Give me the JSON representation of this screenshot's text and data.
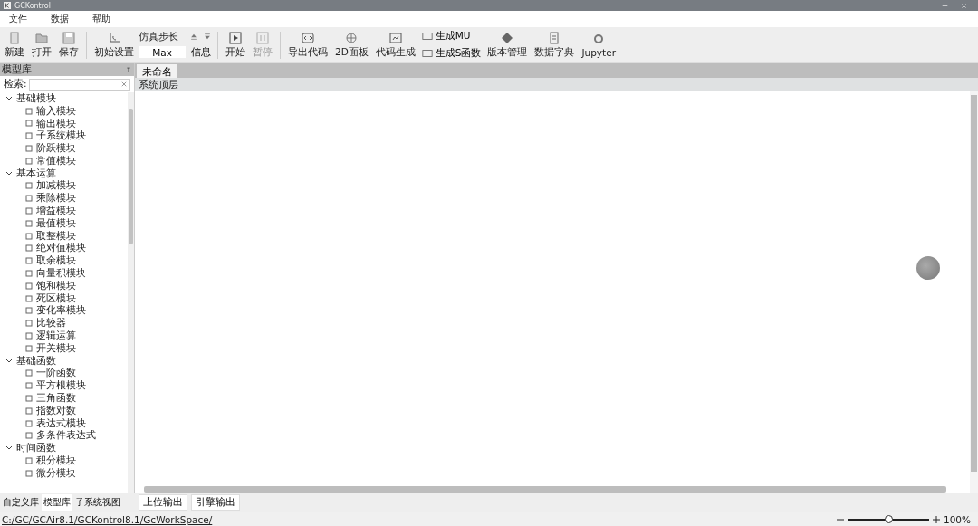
{
  "window": {
    "title": "GCKontrol"
  },
  "menu": [
    "文件",
    "数据",
    "帮助"
  ],
  "toolbar": {
    "file_buttons": [
      {
        "label": "新建"
      },
      {
        "label": "打开"
      },
      {
        "label": "保存"
      }
    ],
    "init_button": {
      "label": "初始设置"
    },
    "sim": {
      "label": "仿真步长",
      "value": "Max",
      "info": "信息"
    },
    "run_buttons": [
      {
        "label": "开始",
        "disabled": false
      },
      {
        "label": "暂停",
        "disabled": true
      }
    ],
    "tool_buttons": [
      {
        "label": "导出代码"
      },
      {
        "label": "2D面板"
      },
      {
        "label": "代码生成"
      }
    ],
    "small_buttons": [
      {
        "label": "生成MU"
      },
      {
        "label": "生成S函数"
      }
    ],
    "extra_buttons": [
      {
        "label": "版本管理"
      },
      {
        "label": "数据字典"
      },
      {
        "label": "Jupyter"
      }
    ]
  },
  "library": {
    "title": "模型库",
    "search_label": "检索:",
    "tree": [
      {
        "label": "基础模块",
        "expanded": true,
        "children": [
          {
            "label": "输入模块"
          },
          {
            "label": "输出模块"
          },
          {
            "label": "子系统模块"
          },
          {
            "label": "阶跃模块"
          },
          {
            "label": "常值模块"
          }
        ]
      },
      {
        "label": "基本运算",
        "expanded": true,
        "children": [
          {
            "label": "加减模块"
          },
          {
            "label": "乘除模块"
          },
          {
            "label": "增益模块"
          },
          {
            "label": "最值模块"
          },
          {
            "label": "取整模块"
          },
          {
            "label": "绝对值模块"
          },
          {
            "label": "取余模块"
          },
          {
            "label": "向量积模块"
          },
          {
            "label": "饱和模块"
          },
          {
            "label": "死区模块"
          },
          {
            "label": "变化率模块"
          },
          {
            "label": "比较器"
          },
          {
            "label": "逻辑运算"
          },
          {
            "label": "开关模块"
          }
        ]
      },
      {
        "label": "基础函数",
        "expanded": true,
        "children": [
          {
            "label": "一阶函数"
          },
          {
            "label": "平方根模块"
          },
          {
            "label": "三角函数"
          },
          {
            "label": "指数对数"
          },
          {
            "label": "表达式模块"
          },
          {
            "label": "多条件表达式"
          }
        ]
      },
      {
        "label": "时间函数",
        "expanded": true,
        "children": [
          {
            "label": "积分模块"
          },
          {
            "label": "微分模块"
          }
        ]
      }
    ]
  },
  "left_tabs": [
    {
      "label": "自定义库",
      "selected": false
    },
    {
      "label": "模型库",
      "selected": true
    },
    {
      "label": "子系统视图",
      "selected": false
    }
  ],
  "doc_tabs": [
    {
      "label": "未命名",
      "selected": true
    }
  ],
  "breadcrumb": "系统顶层",
  "output_tabs": [
    {
      "label": "上位输出",
      "selected": false
    },
    {
      "label": "引擎输出",
      "selected": false
    }
  ],
  "status_bar": {
    "path": "C:/GC/GCAir8.1/GCKontrol8.1/GcWorkSpace/",
    "zoom": {
      "level": 0.5
    },
    "zoom_text": "100%"
  }
}
